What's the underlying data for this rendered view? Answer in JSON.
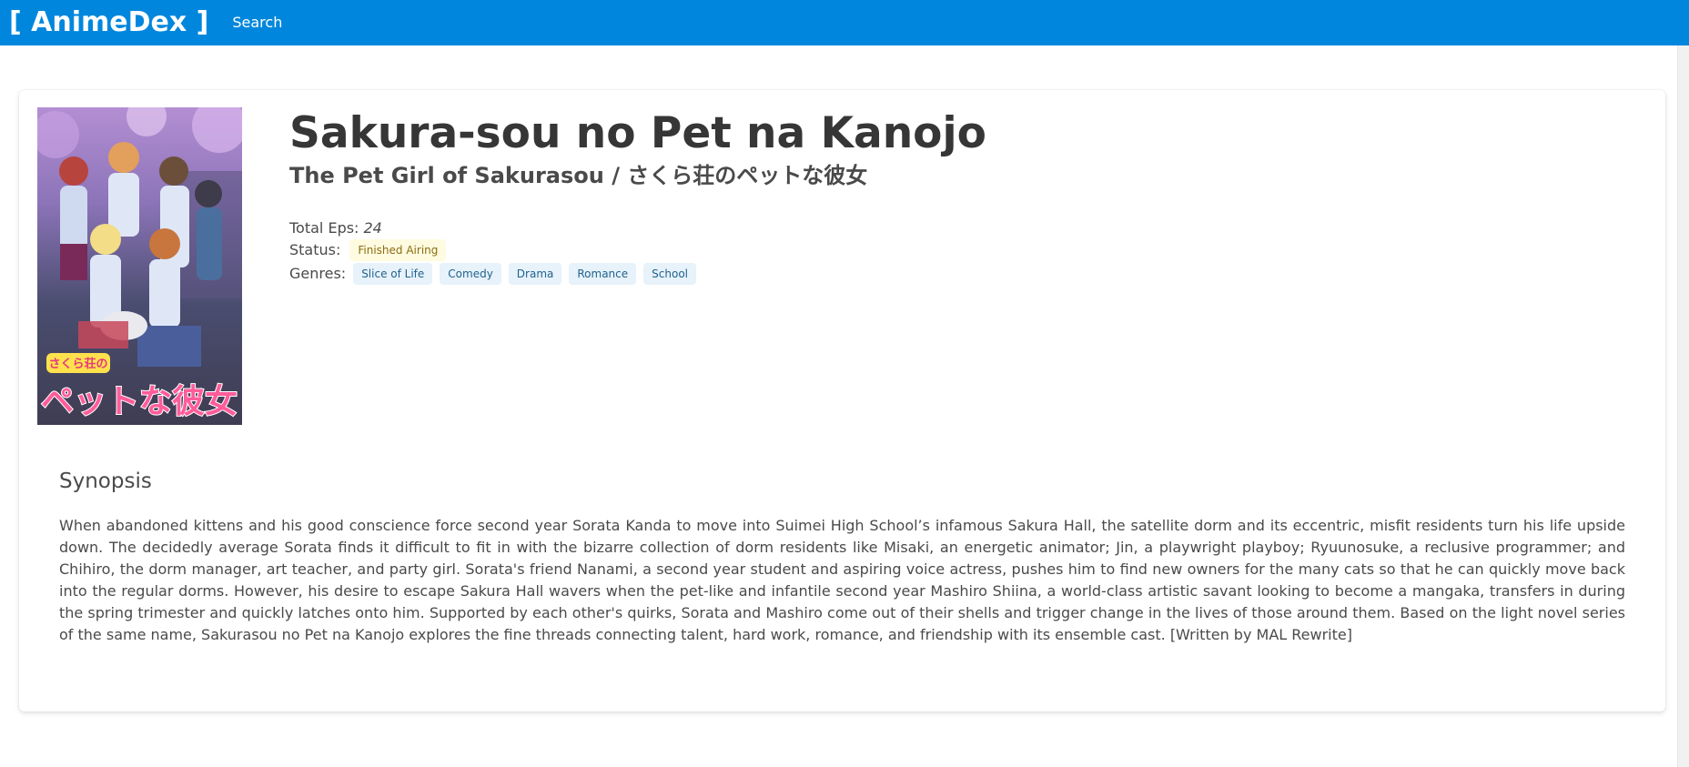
{
  "navbar": {
    "brand": "[ AnimeDex ]",
    "search_link": "Search"
  },
  "anime": {
    "title": "Sakura-sou no Pet na Kanojo",
    "subtitle": "The Pet Girl of Sakurasou / さくら荘のペットな彼女",
    "total_eps_label": "Total Eps:",
    "total_eps_value": "24",
    "status_label": "Status:",
    "status_value": "Finished Airing",
    "genres_label": "Genres:",
    "genres": [
      "Slice of Life",
      "Comedy",
      "Drama",
      "Romance",
      "School"
    ],
    "poster_logo_top": "さくら荘の",
    "poster_logo_main": "ペットな彼女"
  },
  "synopsis": {
    "heading": "Synopsis",
    "text": "When abandoned kittens and his good conscience force second year Sorata Kanda to move into Suimei High School’s infamous Sakura Hall, the satellite dorm and its eccentric, misfit residents turn his life upside down. The decidedly average Sorata finds it difficult to fit in with the bizarre collection of dorm residents like Misaki, an energetic animator; Jin, a playwright playboy; Ryuunosuke, a reclusive programmer; and Chihiro, the dorm manager, art teacher, and party girl. Sorata's friend Nanami, a second year student and aspiring voice actress, pushes him to find new owners for the many cats so that he can quickly move back into the regular dorms. However, his desire to escape Sakura Hall wavers when the pet-like and infantile second year Mashiro Shiina, a world-class artistic savant looking to become a mangaka, transfers in during the spring trimester and quickly latches onto him. Supported by each other's quirks, Sorata and Mashiro come out of their shells and trigger change in the lives of those around them. Based on the light novel series of the same name, Sakurasou no Pet na Kanojo explores the fine threads connecting talent, hard work, romance, and friendship with its ensemble cast. [Written by MAL Rewrite]"
  },
  "colors": {
    "navbar": "#0087dd",
    "status_tag_bg": "#fffbe0",
    "genre_tag_bg": "#e7f2fa",
    "genre_tag_text": "#22638f"
  }
}
